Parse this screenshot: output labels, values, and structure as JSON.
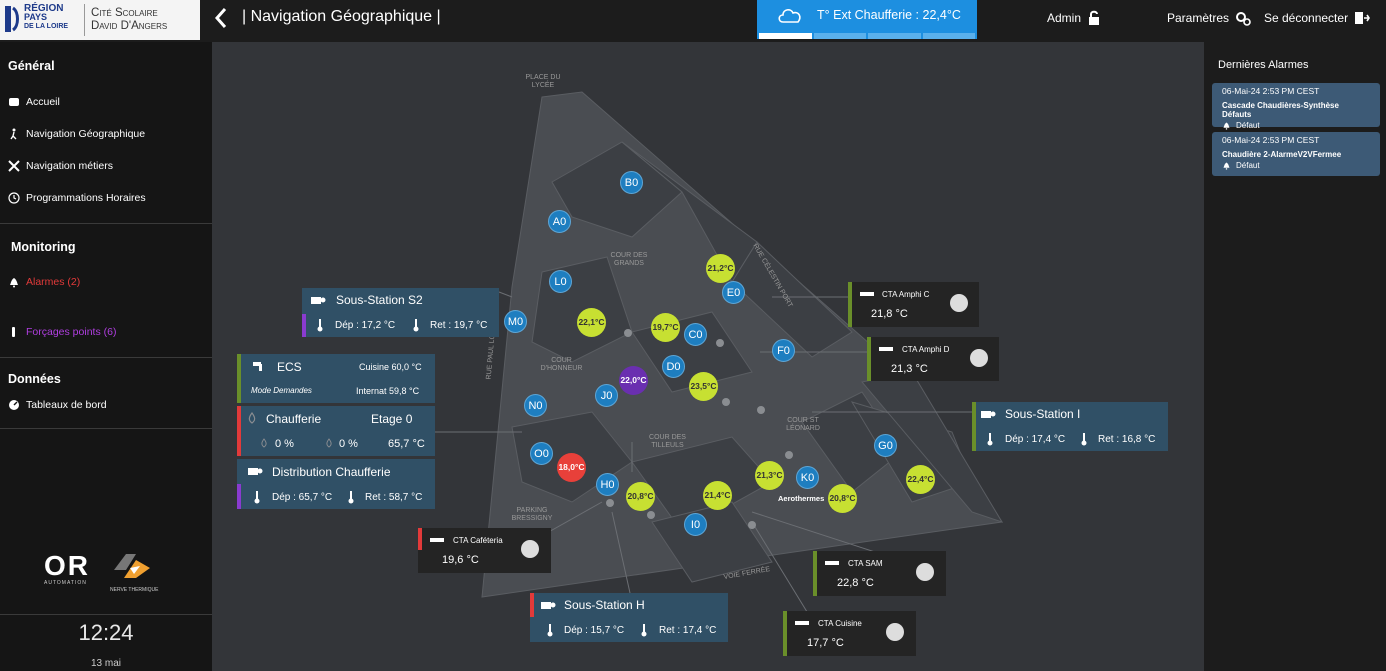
{
  "header": {
    "logo_region_line1": "RÉGION",
    "logo_region_line2": "PAYS",
    "logo_region_line3": "DE LA LOIRE",
    "logo_cite_line1": "Cité Scolaire",
    "logo_cite_line2": "David D'Angers",
    "page_title": "| Navigation Géographique |",
    "weather_text": "T° Ext Chaufferie : 22,4°C",
    "user": "Admin",
    "settings": "Paramètres",
    "logout": "Se déconnecter"
  },
  "sidebar": {
    "section_general": "Général",
    "item_home": "Accueil",
    "item_geo": "Navigation Géographique",
    "item_trades": "Navigation métiers",
    "item_schedules": "Programmations Horaires",
    "section_monitoring": "Monitoring",
    "item_alarms": "Alarmes (2)",
    "item_forcings": "Forçages points (6)",
    "section_data": "Données",
    "item_dashboards": "Tableaux de bord",
    "brand_oris": "OR",
    "brand_oris_sub": "AUTOMATION",
    "brand_nerve": "NERVE THERMIQUE",
    "clock": "12:24",
    "date": "13 mai"
  },
  "alarms_panel": {
    "title": "Dernières Alarmes",
    "items": [
      {
        "time": "06-Mai-24 2:53 PM CEST",
        "name": "Cascade Chaudières-Synthèse Défauts",
        "status": "Défaut"
      },
      {
        "time": "06-Mai-24 2:53 PM CEST",
        "name": "Chaudière 2-AlarmeV2VFermee",
        "status": "Défaut"
      }
    ]
  },
  "map": {
    "labels": {
      "place_lycee": "Place du Lycée",
      "cour_grands": "Cour des Grands",
      "cour_honneur": "Cour d'Honneur",
      "cour_tilleuls": "Cour des Tilleuls",
      "cour_leonard": "Cour St Léonard",
      "parking": "Parking Bressigny",
      "rue_celestin": "Rue Célestin Port",
      "rue_paul": "Rue Paul Louis",
      "voie_ferree": "Voie Ferrée",
      "aerothermes": "Aerothermes"
    },
    "buildings": {
      "B0": "B0",
      "A0": "A0",
      "L0": "L0",
      "E0": "E0",
      "M0": "M0",
      "C0": "C0",
      "D0": "D0",
      "J0": "J0",
      "F0": "F0",
      "N0": "N0",
      "O0": "O0",
      "H0": "H0",
      "K0": "K0",
      "G0": "G0",
      "I0": "I0"
    },
    "temps": {
      "t1": "21,2",
      "t2": "22,1",
      "t3": "19,7",
      "t4": "22,0",
      "t5": "23,5",
      "t6": "18,0",
      "t7": "20,8",
      "t8": "21,4",
      "t9": "21,3",
      "t10": "20,8",
      "t11": "22,4"
    },
    "temp_unit": "°C",
    "cards": {
      "ss2_title": "Sous-Station S2",
      "ss2_dep": "Dép : 17,2 °C",
      "ss2_ret": "Ret : 19,7 °C",
      "ecs_title": "ECS",
      "ecs_cuisine": "Cuisine 60,0 °C",
      "ecs_mode": "Mode Demandes",
      "ecs_internat": "Internat 59,8 °C",
      "chauf_title": "Chaufferie",
      "chauf_etage": "Etage 0",
      "chauf_p1": "0 %",
      "chauf_p2": "0 %",
      "chauf_temp": "65,7 °C",
      "dist_title": "Distribution Chaufferie",
      "dist_dep": "Dép : 65,7 °C",
      "dist_ret": "Ret : 58,7 °C",
      "cta_amphi_c": "CTA Amphi C",
      "cta_amphi_c_val": "21,8 °C",
      "cta_amphi_d": "CTA Amphi D",
      "cta_amphi_d_val": "21,3 °C",
      "ssi_title": "Sous-Station I",
      "ssi_dep": "Dép : 17,4 °C",
      "ssi_ret": "Ret : 16,8 °C",
      "cta_caf": "CTA Caféteria",
      "cta_caf_val": "19,6 °C",
      "cta_sam": "CTA SAM",
      "cta_sam_val": "22,8 °C",
      "ssh_title": "Sous-Station H",
      "ssh_dep": "Dép : 15,7 °C",
      "ssh_ret": "Ret : 17,4 °C",
      "cta_cuisine": "CTA Cuisine",
      "cta_cuisine_val": "17,7 °C"
    }
  },
  "colors": {
    "accent_blue": "#1d8fe0",
    "building_blue": "#1e7ec0",
    "temp_green": "#c7e032",
    "temp_red": "#e8403a",
    "temp_purple": "#6a2fb0",
    "alarm_red": "#e23a3a",
    "forcing_purple": "#b03ee0",
    "status_green": "#6a8f2a"
  }
}
